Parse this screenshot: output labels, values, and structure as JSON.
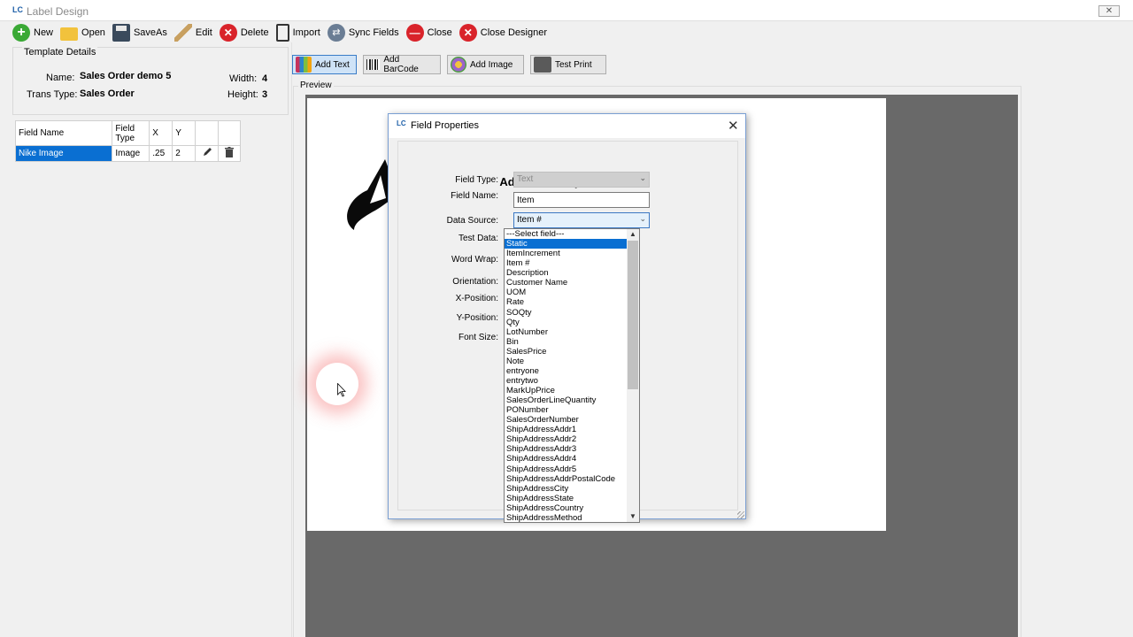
{
  "window": {
    "title": "Label Design",
    "close_glyph": "✕"
  },
  "toolbar": {
    "new_label": "New",
    "open_label": "Open",
    "saveas_label": "SaveAs",
    "edit_label": "Edit",
    "delete_label": "Delete",
    "import_label": "Import",
    "sync_label": "Sync Fields",
    "close_label": "Close",
    "close_designer_label": "Close Designer"
  },
  "template_details": {
    "group_label": "Template Details",
    "name_label": "Name:",
    "name_value": "Sales Order demo 5",
    "trans_type_label": "Trans Type:",
    "trans_type_value": "Sales Order",
    "width_label": "Width:",
    "width_value": "4",
    "height_label": "Height:",
    "height_value": "3"
  },
  "fields_table": {
    "headers": {
      "field_name": "Field Name",
      "field_type": "Field Type",
      "x": "X",
      "y": "Y"
    },
    "rows": [
      {
        "field_name": "Nike Image",
        "field_type": "Image",
        "x": ".25",
        "y": "2"
      }
    ]
  },
  "design_toolbar": {
    "add_text": "Add Text",
    "add_barcode": "Add BarCode",
    "add_image": "Add Image",
    "test_print": "Test Print"
  },
  "preview": {
    "label": "Preview"
  },
  "dialog": {
    "title": "Field Properties",
    "heading": "Add Field Properties",
    "field_type_label": "Field Type:",
    "field_type_value": "Text",
    "field_name_label": "Field Name:",
    "field_name_value": "Item",
    "data_source_label": "Data Source:",
    "data_source_value": "Item #",
    "test_data_label": "Test Data:",
    "word_wrap_label": "Word Wrap:",
    "orientation_label": "Orientation:",
    "x_position_label": "X-Position:",
    "y_position_label": "Y-Position:",
    "font_size_label": "Font Size:",
    "close_glyph": "✕"
  },
  "dropdown": {
    "selected": "Static",
    "options": [
      "---Select field---",
      "Static",
      "ItemIncrement",
      "Item #",
      "Description",
      "Customer Name",
      "UOM",
      "Rate",
      "SOQty",
      "Qty",
      "LotNumber",
      "Bin",
      "SalesPrice",
      "Note",
      "entryone",
      "entrytwo",
      "MarkUpPrice",
      "SalesOrderLineQuantity",
      "PONumber",
      "SalesOrderNumber",
      "ShipAddressAddr1",
      "ShipAddressAddr2",
      "ShipAddressAddr3",
      "ShipAddressAddr4",
      "ShipAddressAddr5",
      "ShipAddressAddrPostalCode",
      "ShipAddressCity",
      "ShipAddressState",
      "ShipAddressCountry",
      "ShipAddressMethod"
    ]
  }
}
